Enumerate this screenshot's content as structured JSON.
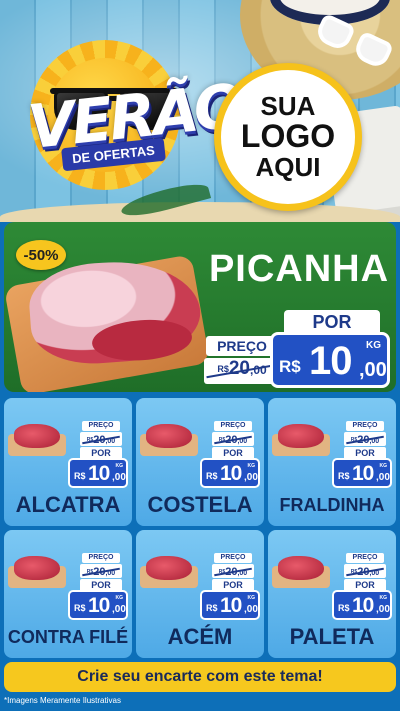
{
  "header": {
    "brand_word": "VERÃO",
    "brand_sub": "DE OFERTAS",
    "logo_placeholder": {
      "line1": "SUA",
      "line2": "LOGO",
      "line3": "AQUI"
    }
  },
  "featured": {
    "discount_badge": "-50%",
    "name": "PICANHA",
    "price_label": "PREÇO",
    "old_price": {
      "currency": "R$",
      "int": "20",
      "dec": ",00"
    },
    "por_label": "POR",
    "new_price": {
      "currency": "R$",
      "int": "10",
      "dec": ",00",
      "unit": "KG"
    }
  },
  "products": [
    {
      "name": "ALCATRA",
      "price_label": "PREÇO",
      "old_currency": "R$",
      "old_int": "20",
      "old_dec": ",00",
      "por_label": "POR",
      "currency": "R$",
      "int": "10",
      "dec": ",00",
      "unit": "KG"
    },
    {
      "name": "COSTELA",
      "price_label": "PREÇO",
      "old_currency": "R$",
      "old_int": "20",
      "old_dec": ",00",
      "por_label": "POR",
      "currency": "R$",
      "int": "10",
      "dec": ",00",
      "unit": "KG"
    },
    {
      "name": "FRALDINHA",
      "price_label": "PREÇO",
      "old_currency": "R$",
      "old_int": "20",
      "old_dec": ",00",
      "por_label": "POR",
      "currency": "R$",
      "int": "10",
      "dec": ",00",
      "unit": "KG"
    },
    {
      "name": "CONTRA FILÉ",
      "price_label": "PREÇO",
      "old_currency": "R$",
      "old_int": "20",
      "old_dec": ",00",
      "por_label": "POR",
      "currency": "R$",
      "int": "10",
      "dec": ",00",
      "unit": "KG"
    },
    {
      "name": "ACÉM",
      "price_label": "PREÇO",
      "old_currency": "R$",
      "old_int": "20",
      "old_dec": ",00",
      "por_label": "POR",
      "currency": "R$",
      "int": "10",
      "dec": ",00",
      "unit": "KG"
    },
    {
      "name": "PALETA",
      "price_label": "PREÇO",
      "old_currency": "R$",
      "old_int": "20",
      "old_dec": ",00",
      "por_label": "POR",
      "currency": "R$",
      "int": "10",
      "dec": ",00",
      "unit": "KG"
    }
  ],
  "footer": {
    "cta": "Crie seu encarte com este tema!",
    "disclaimer": "*Imagens Meramente Ilustrativas"
  },
  "colors": {
    "page_bg": "#0d6fb8",
    "featured_green": "#2e8a36",
    "card_blue": "#4ea9e6",
    "price_blue": "#2251c4",
    "accent_yellow": "#f6c81e"
  },
  "icons": [
    "sunglasses-icon",
    "sun-icon",
    "meat-icon",
    "straw-hat-icon"
  ]
}
